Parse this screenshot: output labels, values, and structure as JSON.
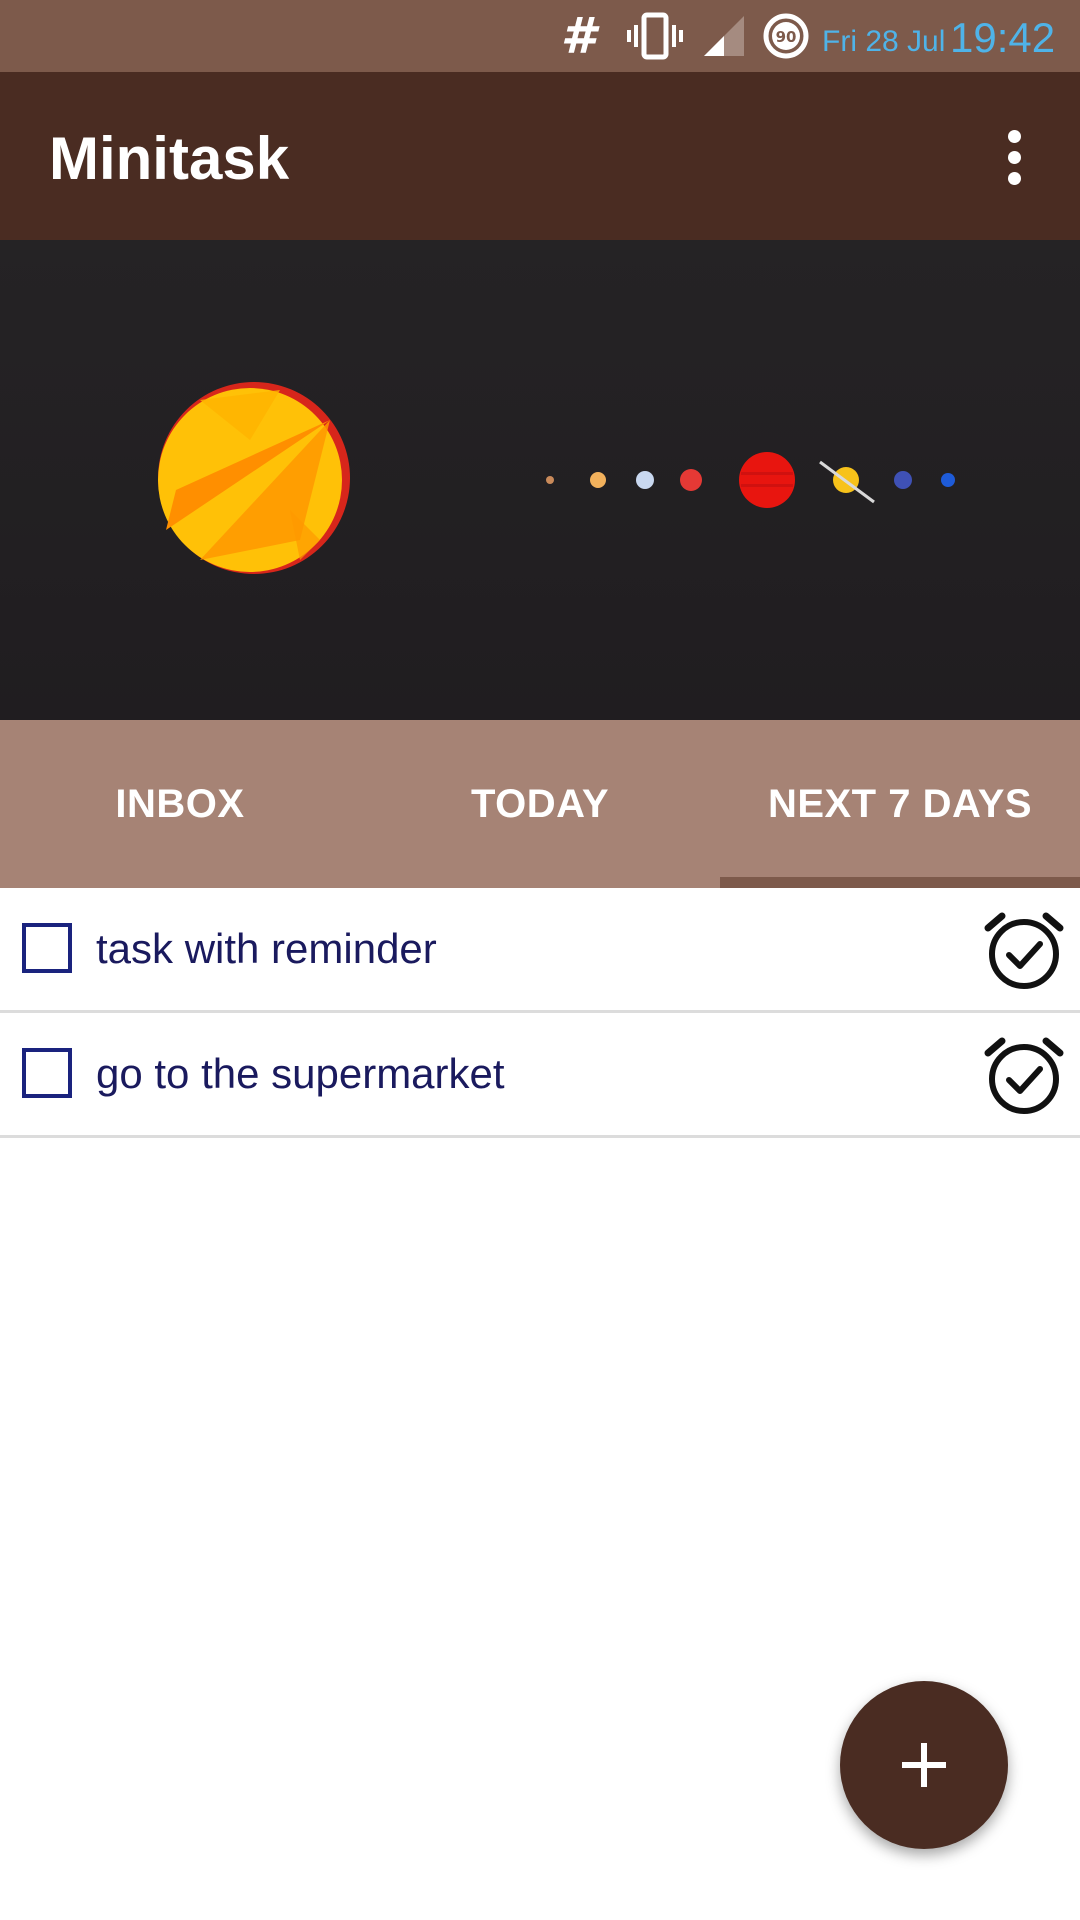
{
  "status_bar": {
    "hash_symbol": "#",
    "battery_level": "90",
    "date": "Fri 28 Jul",
    "time": "19:42",
    "icons": [
      "hash-icon",
      "vibrate-icon",
      "signal-icon",
      "battery-icon"
    ]
  },
  "app_bar": {
    "title": "Minitask",
    "overflow_icon": "more-vert-icon"
  },
  "header": {
    "image": "solar-system-illustration"
  },
  "tabs": [
    {
      "label": "INBOX",
      "selected": false
    },
    {
      "label": "TODAY",
      "selected": false
    },
    {
      "label": "NEXT 7 DAYS",
      "selected": true
    }
  ],
  "tasks": [
    {
      "text": "task with reminder",
      "checked": false,
      "icon": "alarm-check-icon"
    },
    {
      "text": "go to the supermarket",
      "checked": false,
      "icon": "alarm-check-icon"
    }
  ],
  "fab": {
    "icon": "plus-icon"
  },
  "colors": {
    "status_bar": "#7d5a4b",
    "app_bar": "#4a2c22",
    "tab_bar": "#a68375",
    "tab_indicator": "#7d5a4b",
    "accent_text": "#4fb3e8",
    "checkbox": "#1a237e",
    "fab": "#4a2c22"
  }
}
